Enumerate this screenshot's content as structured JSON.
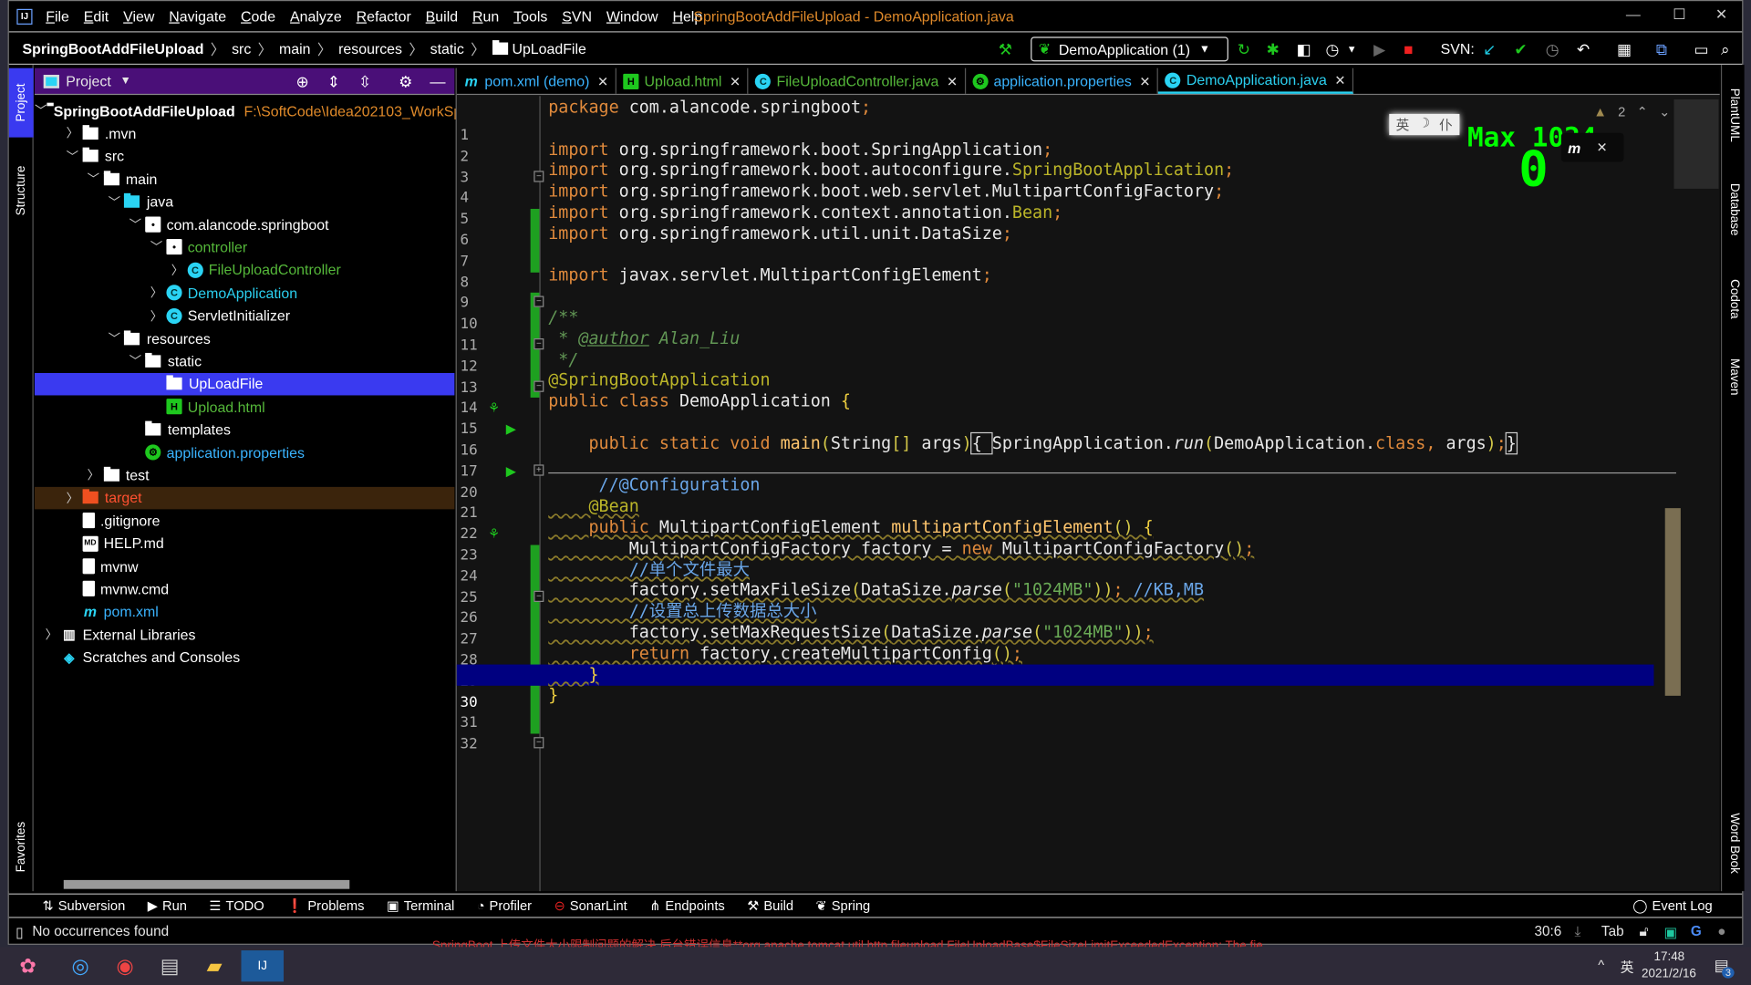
{
  "menubar": {
    "items": [
      "File",
      "Edit",
      "View",
      "Navigate",
      "Code",
      "Analyze",
      "Refactor",
      "Build",
      "Run",
      "Tools",
      "SVN",
      "Window",
      "Help"
    ],
    "title": "SpringBootAddFileUpload - DemoApplication.java"
  },
  "breadcrumb": [
    "SpringBootAddFileUpload",
    "src",
    "main",
    "resources",
    "static",
    "UpLoadFile"
  ],
  "toolbar": {
    "run_config": "DemoApplication (1)",
    "svn_label": "SVN:"
  },
  "left_strip": {
    "project": "Project",
    "structure": "Structure",
    "favorites": "Favorites"
  },
  "right_strip": {
    "plantuml": "PlantUML",
    "database": "Database",
    "codota": "Codota",
    "maven": "Maven",
    "wordbook": "Word Book"
  },
  "project": {
    "title": "Project",
    "root_path": "F:\\SoftCode\\Idea202103_WorkSp",
    "tree": [
      {
        "label": "SpringBootAddFileUpload",
        "level": 0,
        "state": "open",
        "icon": "module",
        "color": "#ffffff",
        "bold": true
      },
      {
        "label": ".mvn",
        "level": 1,
        "state": "closed",
        "icon": "folder",
        "color": "#ffffff"
      },
      {
        "label": "src",
        "level": 1,
        "state": "open",
        "icon": "folder",
        "color": "#ffffff"
      },
      {
        "label": "main",
        "level": 2,
        "state": "open",
        "icon": "folder",
        "color": "#ffffff"
      },
      {
        "label": "java",
        "level": 3,
        "state": "open",
        "icon": "folder-source",
        "color": "#ffffff"
      },
      {
        "label": "com.alancode.springboot",
        "level": 4,
        "state": "open",
        "icon": "package",
        "color": "#ffffff"
      },
      {
        "label": "controller",
        "level": 5,
        "state": "open",
        "icon": "package",
        "color": "#55b83a"
      },
      {
        "label": "FileUploadController",
        "level": 6,
        "state": "closed",
        "icon": "class",
        "color": "#55b83a"
      },
      {
        "label": "DemoApplication",
        "level": 5,
        "state": "closed",
        "icon": "class-spring",
        "color": "#2bd0f0"
      },
      {
        "label": "ServletInitializer",
        "level": 5,
        "state": "closed",
        "icon": "class",
        "color": "#ffffff"
      },
      {
        "label": "resources",
        "level": 3,
        "state": "open",
        "icon": "folder-resources",
        "color": "#ffffff"
      },
      {
        "label": "static",
        "level": 4,
        "state": "open",
        "icon": "folder",
        "color": "#ffffff"
      },
      {
        "label": "UpLoadFile",
        "level": 5,
        "state": "none",
        "icon": "folder",
        "color": "#ffffff",
        "selected": true
      },
      {
        "label": "Upload.html",
        "level": 5,
        "state": "none",
        "icon": "html",
        "color": "#55b83a"
      },
      {
        "label": "templates",
        "level": 4,
        "state": "none",
        "icon": "folder",
        "color": "#ffffff"
      },
      {
        "label": "application.properties",
        "level": 4,
        "state": "none",
        "icon": "properties",
        "color": "#3ab4ff"
      },
      {
        "label": "test",
        "level": 2,
        "state": "closed",
        "icon": "folder",
        "color": "#ffffff"
      },
      {
        "label": "target",
        "level": 1,
        "state": "closed",
        "icon": "folder-excluded",
        "color": "#ff5030",
        "excluded": true
      },
      {
        "label": ".gitignore",
        "level": 1,
        "state": "none",
        "icon": "file",
        "color": "#ffffff"
      },
      {
        "label": "HELP.md",
        "level": 1,
        "state": "none",
        "icon": "markdown",
        "color": "#ffffff"
      },
      {
        "label": "mvnw",
        "level": 1,
        "state": "none",
        "icon": "file",
        "color": "#ffffff"
      },
      {
        "label": "mvnw.cmd",
        "level": 1,
        "state": "none",
        "icon": "file",
        "color": "#ffffff"
      },
      {
        "label": "pom.xml",
        "level": 1,
        "state": "none",
        "icon": "maven",
        "color": "#3ab4ff"
      },
      {
        "label": "External Libraries",
        "level": 0,
        "state": "closed",
        "icon": "libraries",
        "color": "#ffffff"
      },
      {
        "label": "Scratches and Consoles",
        "level": 0,
        "state": "none",
        "icon": "scratches",
        "color": "#ffffff"
      }
    ]
  },
  "tabs": [
    {
      "label": "pom.xml (demo)",
      "color": "#3ab4ff",
      "icon": "maven"
    },
    {
      "label": "Upload.html",
      "color": "#55b83a",
      "icon": "html"
    },
    {
      "label": "FileUploadController.java",
      "color": "#55b83a",
      "icon": "class"
    },
    {
      "label": "application.properties",
      "color": "#3ab4ff",
      "icon": "properties"
    },
    {
      "label": "DemoApplication.java",
      "color": "#2bd0f0",
      "icon": "class-spring",
      "active": true
    }
  ],
  "editor": {
    "warnings": "2",
    "overlay_text": "Max 1024",
    "overlay_digit": "0",
    "ime": [
      "英",
      "☽",
      "仆"
    ],
    "current_line": "30",
    "lines": [
      {
        "n": "1",
        "t": [
          [
            "k",
            "package "
          ],
          [
            "d",
            "com.alancode.springboot"
          ],
          [
            "p",
            ";"
          ]
        ]
      },
      {
        "n": "2",
        "t": []
      },
      {
        "n": "3",
        "t": [
          [
            "k",
            "import "
          ],
          [
            "d",
            "org.springframework.boot.SpringApplication"
          ],
          [
            "p",
            ";"
          ]
        ]
      },
      {
        "n": "4",
        "t": [
          [
            "k",
            "import "
          ],
          [
            "d",
            "org.springframework.boot.autoconfigure."
          ],
          [
            "an",
            "SpringBootApplication"
          ],
          [
            "p",
            ";"
          ]
        ]
      },
      {
        "n": "5",
        "t": [
          [
            "k",
            "import "
          ],
          [
            "d",
            "org.springframework.boot.web.servlet.MultipartConfigFactory"
          ],
          [
            "p",
            ";"
          ]
        ]
      },
      {
        "n": "6",
        "t": [
          [
            "k",
            "import "
          ],
          [
            "d",
            "org.springframework.context.annotation."
          ],
          [
            "an",
            "Bean"
          ],
          [
            "p",
            ";"
          ]
        ]
      },
      {
        "n": "7",
        "t": [
          [
            "k",
            "import "
          ],
          [
            "d",
            "org.springframework.util.unit.DataSize"
          ],
          [
            "p",
            ";"
          ]
        ]
      },
      {
        "n": "8",
        "t": []
      },
      {
        "n": "9",
        "t": [
          [
            "k",
            "import "
          ],
          [
            "d",
            "javax.servlet.MultipartConfigElement"
          ],
          [
            "p",
            ";"
          ]
        ]
      },
      {
        "n": "10",
        "t": []
      },
      {
        "n": "11",
        "t": [
          [
            "dc",
            "/**"
          ]
        ]
      },
      {
        "n": "12",
        "t": [
          [
            "dc",
            " * "
          ],
          [
            "dt",
            "@author"
          ],
          [
            "dc",
            " Alan_Liu"
          ]
        ]
      },
      {
        "n": "13",
        "t": [
          [
            "dc",
            " */"
          ]
        ]
      },
      {
        "n": "14",
        "t": [
          [
            "an",
            "@SpringBootApplication"
          ]
        ]
      },
      {
        "n": "15",
        "t": [
          [
            "k",
            "public class "
          ],
          [
            "d",
            "DemoApplication "
          ],
          [
            "br",
            "{"
          ]
        ]
      },
      {
        "n": "16",
        "t": []
      },
      {
        "n": "17",
        "t": [
          [
            "d",
            "    "
          ],
          [
            "k",
            "public static void "
          ],
          [
            "m",
            "main"
          ],
          [
            "y",
            "("
          ],
          [
            "d",
            "String"
          ],
          [
            "y",
            "[]"
          ],
          [
            "d",
            " args"
          ],
          [
            "y",
            ")"
          ],
          [
            "box",
            "{ "
          ],
          [
            "d",
            "SpringApplication."
          ],
          [
            "it",
            "run"
          ],
          [
            "y",
            "("
          ],
          [
            "d",
            "DemoApplication."
          ],
          [
            "k",
            "class"
          ],
          [
            "p",
            ", "
          ],
          [
            "d",
            "args"
          ],
          [
            "y",
            ")"
          ],
          [
            "p",
            ";"
          ],
          [
            "box",
            "}"
          ]
        ]
      },
      {
        "n": "20",
        "t": []
      },
      {
        "n": "21",
        "t": [
          [
            "d",
            "     "
          ],
          [
            "lc",
            "//@Configuration"
          ]
        ]
      },
      {
        "n": "22",
        "t": [
          [
            "d",
            "    "
          ],
          [
            "an",
            "@Bean"
          ]
        ]
      },
      {
        "n": "23",
        "t": [
          [
            "d",
            "    "
          ],
          [
            "k",
            "public "
          ],
          [
            "d",
            "MultipartConfigElement "
          ],
          [
            "m",
            "multipartConfigElement"
          ],
          [
            "y",
            "() "
          ],
          [
            "br",
            "{"
          ]
        ]
      },
      {
        "n": "24",
        "t": [
          [
            "d",
            "        MultipartConfigFactory factory = "
          ],
          [
            "k",
            "new "
          ],
          [
            "d",
            "MultipartConfigFactory"
          ],
          [
            "y",
            "()"
          ],
          [
            "p",
            ";"
          ]
        ]
      },
      {
        "n": "25",
        "t": [
          [
            "d",
            "        "
          ],
          [
            "lc",
            "//单个文件最大"
          ]
        ]
      },
      {
        "n": "26",
        "t": [
          [
            "d",
            "        factory.setMaxFileSize"
          ],
          [
            "y",
            "("
          ],
          [
            "d",
            "DataSize."
          ],
          [
            "it",
            "parse"
          ],
          [
            "y",
            "("
          ],
          [
            "s",
            "\"1024MB\""
          ],
          [
            "y",
            "))"
          ],
          [
            "p",
            "; "
          ],
          [
            "lc",
            "//KB,MB"
          ]
        ]
      },
      {
        "n": "27",
        "t": [
          [
            "d",
            "        "
          ],
          [
            "lc",
            "//设置总上传数据总大小"
          ]
        ]
      },
      {
        "n": "28",
        "t": [
          [
            "d",
            "        factory.setMaxRequestSize"
          ],
          [
            "y",
            "("
          ],
          [
            "d",
            "DataSize."
          ],
          [
            "it",
            "parse"
          ],
          [
            "y",
            "("
          ],
          [
            "s",
            "\"1024MB\""
          ],
          [
            "y",
            "))"
          ],
          [
            "p",
            ";"
          ]
        ]
      },
      {
        "n": "29",
        "t": [
          [
            "d",
            "        "
          ],
          [
            "k",
            "return "
          ],
          [
            "d",
            "factory.createMultipartConfig"
          ],
          [
            "y",
            "()"
          ],
          [
            "p",
            ";"
          ]
        ]
      },
      {
        "n": "30",
        "t": [
          [
            "d",
            "    "
          ],
          [
            "br",
            "}"
          ]
        ]
      },
      {
        "n": "31",
        "t": [
          [
            "br",
            "}"
          ]
        ]
      },
      {
        "n": "32",
        "t": []
      }
    ]
  },
  "toolwindows": [
    {
      "label": "Subversion",
      "icon": "subversion-icon",
      "glyph": "⇅"
    },
    {
      "label": "Run",
      "icon": "run-icon",
      "glyph": "▶"
    },
    {
      "label": "TODO",
      "icon": "todo-icon",
      "glyph": "☰"
    },
    {
      "label": "Problems",
      "icon": "problems-icon",
      "glyph": "❗"
    },
    {
      "label": "Terminal",
      "icon": "terminal-icon",
      "glyph": "▣"
    },
    {
      "label": "Profiler",
      "icon": "profiler-icon",
      "glyph": "◔"
    },
    {
      "label": "SonarLint",
      "icon": "sonarlint-icon",
      "glyph": "⊖"
    },
    {
      "label": "Endpoints",
      "icon": "endpoints-icon",
      "glyph": "⋔"
    },
    {
      "label": "Build",
      "icon": "build-hammer-icon",
      "glyph": "⚒"
    },
    {
      "label": "Spring",
      "icon": "spring-leaf-icon",
      "glyph": "❦"
    }
  ],
  "event_log": "Event Log",
  "status": {
    "message": "No occurrences found",
    "position": "30:6",
    "indent": "Tab"
  },
  "background_text": "SpringBoot 上传文件大小限制问题的解决 后台错误信息**org.apache.tomcat.util.http.fileupload.FileUploadBase$FileSizeLimitExceededException: The fie",
  "taskbar": {
    "time": "17:48",
    "date": "2021/2/16",
    "lang": "英",
    "notifications": "3"
  },
  "colors": {
    "accent_purple": "#4a0f78",
    "selection": "#3a3af0",
    "current_line": "#000080",
    "change_marker": "#1ea020",
    "title": "#e08a2a"
  }
}
